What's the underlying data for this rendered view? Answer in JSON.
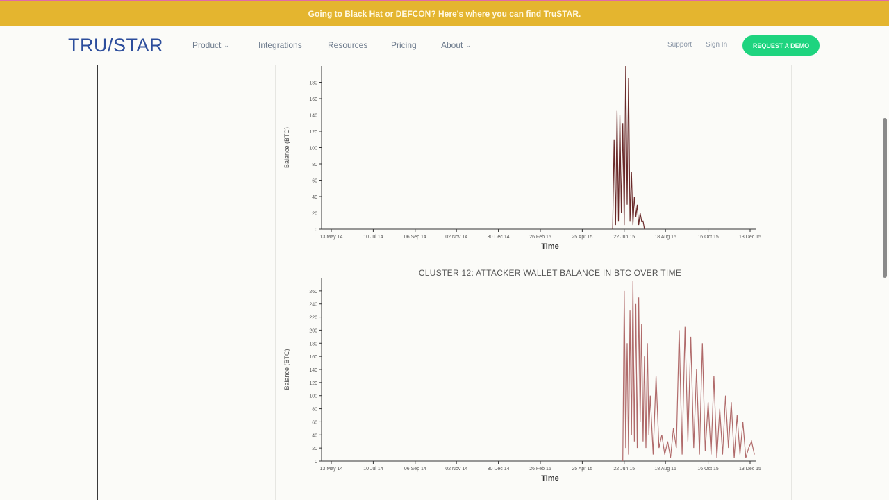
{
  "banner": {
    "text": "Going to Black Hat or DEFCON? Here's where you can find TruSTAR."
  },
  "nav": {
    "logo": "TRU/STAR",
    "items": [
      {
        "label": "Product",
        "dropdown": true
      },
      {
        "label": "Integrations",
        "dropdown": false
      },
      {
        "label": "Resources",
        "dropdown": false
      },
      {
        "label": "Pricing",
        "dropdown": false
      },
      {
        "label": "About",
        "dropdown": true
      }
    ],
    "support": "Support",
    "signin": "Sign In",
    "demo": "REQUEST A DEMO"
  },
  "colors": {
    "banner": "#e4b52f",
    "demo_button": "#1ed47f",
    "logo": "#2c4d9c",
    "chart1_line": "#6a2a2a",
    "chart2_line": "#b06a6a"
  },
  "chart_data": [
    {
      "type": "line",
      "title": "",
      "xlabel": "Time",
      "ylabel": "Balance (BTC)",
      "x_ticks": [
        "13 May 14",
        "10 Jul 14",
        "06 Sep 14",
        "02 Nov 14",
        "30 Dec 14",
        "26 Feb 15",
        "25 Apr 15",
        "22 Jun 15",
        "18 Aug 15",
        "16 Oct 15",
        "13 Dec 15"
      ],
      "y_ticks": [
        0,
        20,
        40,
        60,
        80,
        100,
        120,
        140,
        160,
        180
      ],
      "ylim": [
        0,
        200
      ],
      "x": [
        "2015-06-06",
        "2015-06-08",
        "2015-06-10",
        "2015-06-12",
        "2015-06-14",
        "2015-06-16",
        "2015-06-18",
        "2015-06-20",
        "2015-06-22",
        "2015-06-24",
        "2015-06-26",
        "2015-06-28",
        "2015-06-30",
        "2015-07-02",
        "2015-07-04",
        "2015-07-06",
        "2015-07-08",
        "2015-07-10",
        "2015-07-12",
        "2015-07-14",
        "2015-07-16",
        "2015-07-18",
        "2015-07-20"
      ],
      "y": [
        0,
        110,
        5,
        145,
        10,
        140,
        20,
        130,
        5,
        200,
        30,
        185,
        10,
        70,
        5,
        40,
        15,
        30,
        5,
        20,
        10,
        10,
        0
      ]
    },
    {
      "type": "line",
      "title": "CLUSTER 12: ATTACKER WALLET BALANCE IN BTC OVER TIME",
      "xlabel": "Time",
      "ylabel": "Balance (BTC)",
      "x_ticks": [
        "13 May 14",
        "10 Jul 14",
        "06 Sep 14",
        "02 Nov 14",
        "30 Dec 14",
        "26 Feb 15",
        "25 Apr 15",
        "22 Jun 15",
        "18 Aug 15",
        "16 Oct 15",
        "13 Dec 15"
      ],
      "y_ticks": [
        0,
        20,
        40,
        60,
        80,
        100,
        120,
        140,
        160,
        180,
        200,
        220,
        240,
        260
      ],
      "ylim": [
        0,
        280
      ],
      "x": [
        "2015-06-20",
        "2015-06-22",
        "2015-06-24",
        "2015-06-26",
        "2015-06-28",
        "2015-06-30",
        "2015-07-02",
        "2015-07-04",
        "2015-07-06",
        "2015-07-08",
        "2015-07-10",
        "2015-07-12",
        "2015-07-14",
        "2015-07-16",
        "2015-07-18",
        "2015-07-20",
        "2015-07-22",
        "2015-07-24",
        "2015-07-26",
        "2015-07-28",
        "2015-08-01",
        "2015-08-05",
        "2015-08-09",
        "2015-08-13",
        "2015-08-17",
        "2015-08-21",
        "2015-08-25",
        "2015-08-29",
        "2015-09-02",
        "2015-09-06",
        "2015-09-10",
        "2015-09-14",
        "2015-09-18",
        "2015-09-22",
        "2015-09-26",
        "2015-09-30",
        "2015-10-04",
        "2015-10-08",
        "2015-10-12",
        "2015-10-16",
        "2015-10-20",
        "2015-10-24",
        "2015-10-28",
        "2015-11-01",
        "2015-11-05",
        "2015-11-09",
        "2015-11-13",
        "2015-11-17",
        "2015-11-21",
        "2015-11-25",
        "2015-11-29",
        "2015-12-03",
        "2015-12-07",
        "2015-12-11",
        "2015-12-15",
        "2015-12-19"
      ],
      "y": [
        0,
        260,
        20,
        180,
        10,
        230,
        40,
        275,
        30,
        240,
        20,
        250,
        60,
        210,
        30,
        160,
        20,
        180,
        40,
        100,
        10,
        130,
        20,
        40,
        10,
        30,
        5,
        50,
        20,
        200,
        10,
        205,
        30,
        190,
        20,
        140,
        10,
        180,
        15,
        90,
        10,
        130,
        5,
        80,
        10,
        100,
        20,
        90,
        5,
        70,
        10,
        60,
        5,
        20,
        30,
        10
      ]
    }
  ]
}
